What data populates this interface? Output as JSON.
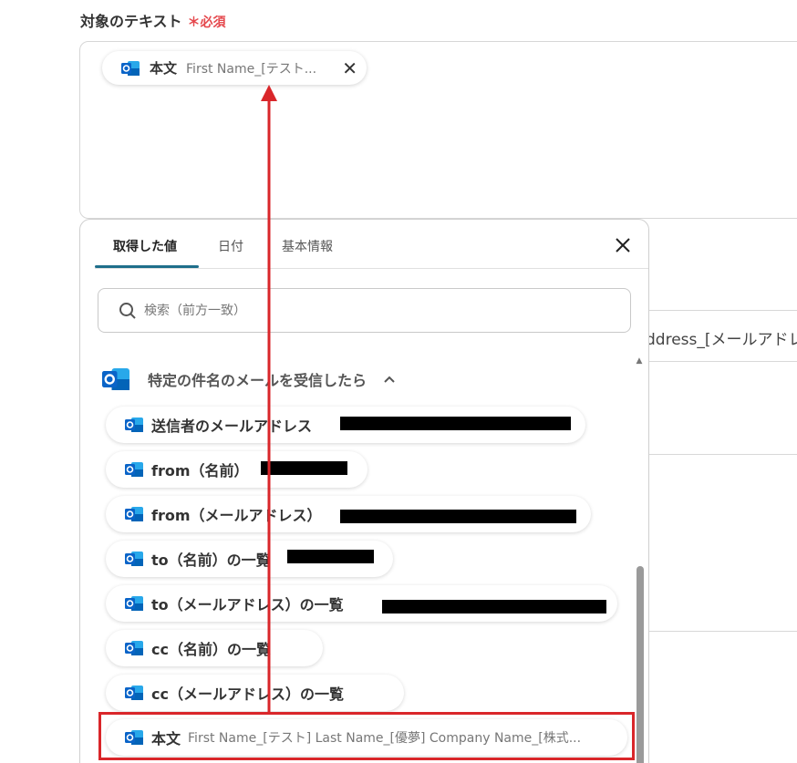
{
  "field": {
    "label": "対象のテキスト",
    "required_mark": "＊",
    "required_text": "必須"
  },
  "selected_chip": {
    "name": "本文",
    "value": "First Name_[テスト..."
  },
  "background_field_text": "ddress_[メールアドレ",
  "popup": {
    "tabs": [
      {
        "label": "取得した値"
      },
      {
        "label": "日付"
      },
      {
        "label": "基本情報"
      }
    ],
    "search_placeholder": "検索（前方一致）",
    "group_title": "特定の件名のメールを受信したら",
    "items": [
      {
        "label": "送信者のメールアドレス",
        "value": ""
      },
      {
        "label": "from（名前）",
        "value": ""
      },
      {
        "label": "from（メールアドレス）",
        "value": ""
      },
      {
        "label": "to（名前）の一覧",
        "value": ""
      },
      {
        "label": "to（メールアドレス）の一覧",
        "value": ""
      },
      {
        "label": "cc（名前）の一覧",
        "value": ""
      },
      {
        "label": "cc（メールアドレス）の一覧",
        "value": ""
      },
      {
        "label": "本文",
        "value": "First Name_[テスト] Last Name_[優夢] Company Name_[株式..."
      }
    ]
  },
  "colors": {
    "accent": "#1f6f8b",
    "required": "#e5484d",
    "annotation": "#d9262a",
    "outlook_blue": "#0a64c8"
  }
}
